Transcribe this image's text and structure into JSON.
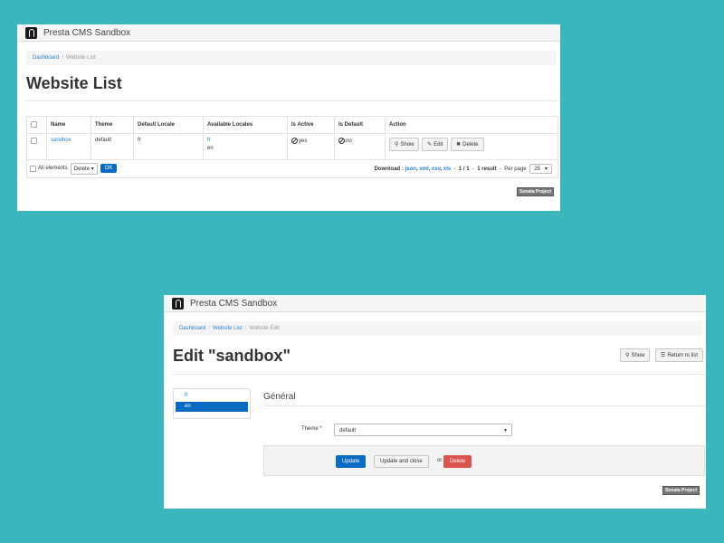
{
  "colors": {
    "background": "#3cb6bd",
    "primary": "#0a6bc2",
    "danger": "#d9534f",
    "link": "#2a7fd4"
  },
  "win1": {
    "brand": "Presta CMS Sandbox",
    "breadcrumb": [
      "Dashboard",
      "Website List"
    ],
    "title": "Website List",
    "columns": [
      "Name",
      "Theme",
      "Default Locale",
      "Available Locales",
      "Is Active",
      "Is Default",
      "Action"
    ],
    "rows": [
      {
        "name": "sandbox",
        "theme": "default",
        "default_locale": "fr",
        "locales": [
          "fr",
          "en"
        ],
        "is_active": "yes",
        "is_default": "no"
      }
    ],
    "actions": {
      "show": "Show",
      "edit": "Edit",
      "delete": "Delete"
    },
    "footer": {
      "all_elements": "All elements",
      "batch_action": "Delete",
      "ok": "OK",
      "download_label": "Download :",
      "download_formats": [
        "json",
        "xml",
        "csv",
        "xls"
      ],
      "pages": "1 / 1",
      "results": "1 result",
      "per_page_label": "Per page",
      "per_page": "25"
    },
    "powered": "Sonata Project"
  },
  "win2": {
    "brand": "Presta CMS Sandbox",
    "breadcrumb": [
      "Dashboard",
      "Website List",
      "Website Edit"
    ],
    "title": "Edit \"sandbox\"",
    "show": "Show",
    "return": "Return to list",
    "locales": [
      "fr",
      "en"
    ],
    "section": "Général",
    "theme_label": "Theme *",
    "theme_value": "default",
    "update": "Update",
    "update_close": "Update and close",
    "or": "or",
    "delete": "Delete",
    "powered": "Sonata Project"
  }
}
